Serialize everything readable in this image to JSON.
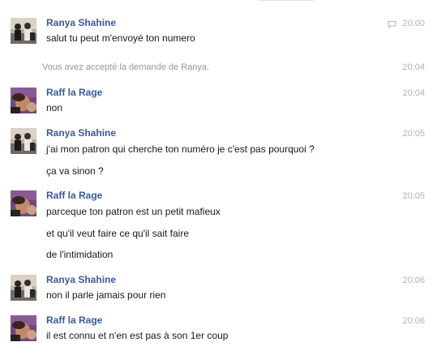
{
  "colors": {
    "sender": "#3b5998",
    "text": "#141823",
    "timestamp": "#adb2bb",
    "system": "#9197a3"
  },
  "messages": [
    {
      "sender": "Ranya Shahine",
      "time": "20:00",
      "icon": "chat-bubble-icon",
      "lines": [
        "salut tu peut m'envoyé ton numero"
      ]
    },
    {
      "system": "Vous avez accepté la demande de Ranya.",
      "time": "20:04"
    },
    {
      "sender": "Raff la Rage",
      "time": "20:04",
      "lines": [
        "non"
      ]
    },
    {
      "sender": "Ranya Shahine",
      "time": "20:05",
      "lines": [
        "j'ai mon patron qui cherche ton numéro je c'est pas pourquoi ?",
        "ça va sinon ?"
      ]
    },
    {
      "sender": "Raff la Rage",
      "time": "20:05",
      "lines": [
        "parceque ton patron est un petit mafieux",
        "et qu'il veut faire ce qu'il sait faire",
        "de l'intimidation"
      ]
    },
    {
      "sender": "Ranya Shahine",
      "time": "20:06",
      "lines": [
        "non il parle jamais pour rien"
      ]
    },
    {
      "sender": "Raff la Rage",
      "time": "20:06",
      "lines": [
        "il est connu et n'en est pas à son 1er coup"
      ]
    }
  ]
}
